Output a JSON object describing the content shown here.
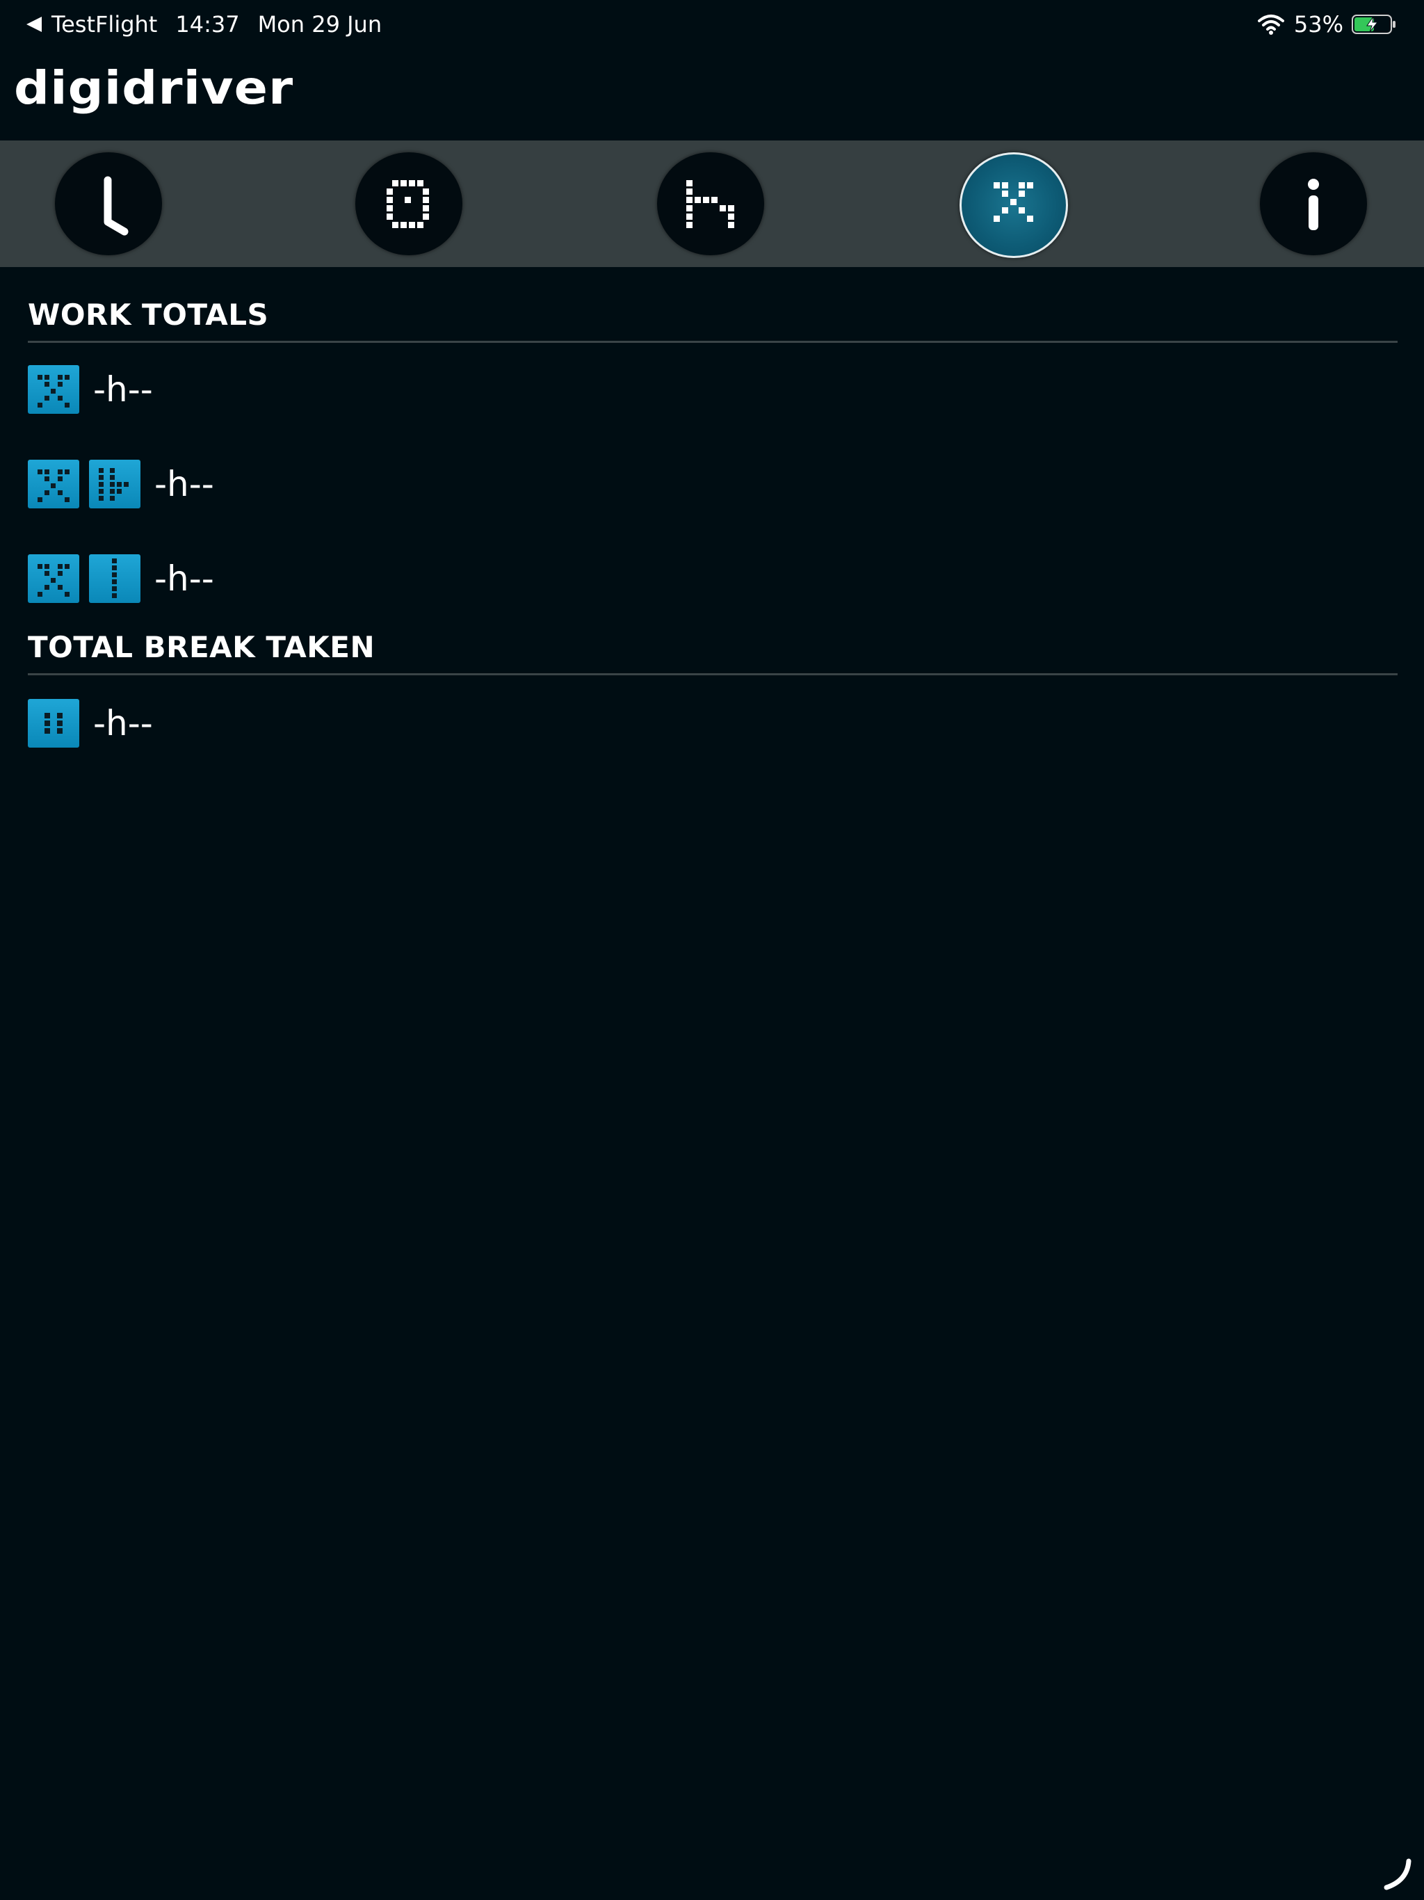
{
  "status_bar": {
    "back_app": "TestFlight",
    "time": "14:37",
    "date": "Mon 29 Jun",
    "battery": "53%"
  },
  "header": {
    "logo": "digidriver"
  },
  "tabs": [
    {
      "icon": "clock-icon",
      "active": false
    },
    {
      "icon": "card-reader-icon",
      "active": false
    },
    {
      "icon": "bed-icon",
      "active": false
    },
    {
      "icon": "work-hammers-icon",
      "active": true
    },
    {
      "icon": "info-icon",
      "active": false
    }
  ],
  "work_totals": {
    "title": "WORK TOTALS",
    "rows": [
      {
        "icons": [
          "work-icon"
        ],
        "value": "-h--"
      },
      {
        "icons": [
          "work-icon",
          "availability-icon"
        ],
        "value": "-h--"
      },
      {
        "icons": [
          "work-icon",
          "driving-icon"
        ],
        "value": "-h--"
      }
    ]
  },
  "break_totals": {
    "title": "TOTAL BREAK TAKEN",
    "rows": [
      {
        "icons": [
          "break-icon"
        ],
        "value": "-h--"
      }
    ]
  },
  "colors": {
    "background": "#000d13",
    "tab_bar": "#363f41",
    "accent": "#1fa6d6"
  }
}
